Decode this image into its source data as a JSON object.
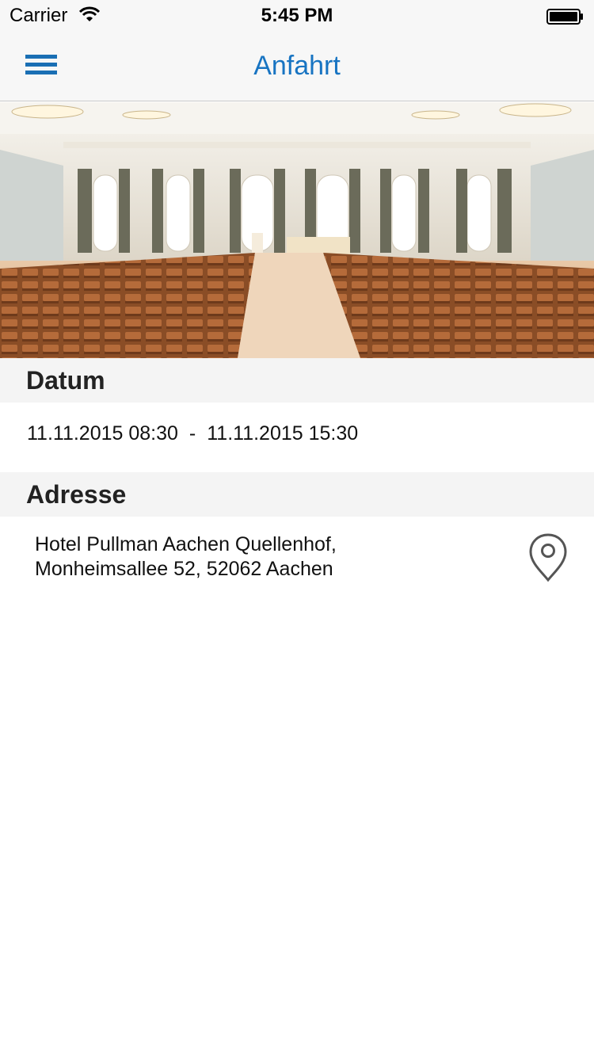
{
  "status_bar": {
    "carrier": "Carrier",
    "time": "5:45 PM"
  },
  "nav": {
    "title": "Anfahrt",
    "menu_icon": "hamburger-menu-icon",
    "accent_color": "#1874c2"
  },
  "hero_image": {
    "subject": "conference hall with rows of chairs"
  },
  "datum": {
    "header": "Datum",
    "start": "11.11.2015 08:30",
    "separator": "-",
    "end": "11.11.2015 15:30"
  },
  "adresse": {
    "header": "Adresse",
    "line1": "Hotel Pullman Aachen Quellenhof,",
    "line2": "Monheimsallee 52, 52062 Aachen",
    "map_icon": "map-pin-icon"
  }
}
